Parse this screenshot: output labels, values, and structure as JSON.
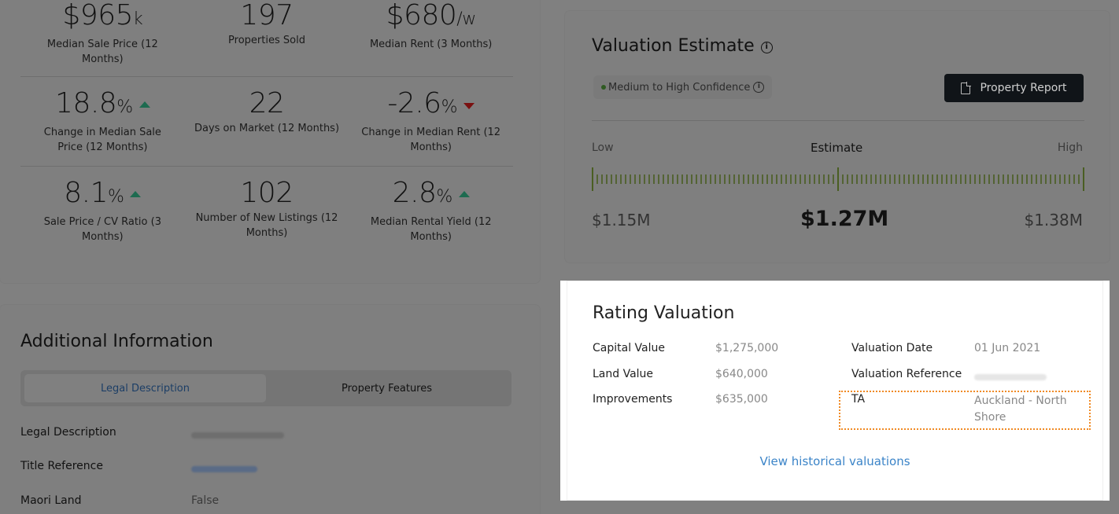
{
  "market_stats": [
    [
      {
        "value": "$965",
        "unit": "k",
        "label": "Median Sale Price (12 Months)",
        "trend": ""
      },
      {
        "value": "197",
        "unit": "",
        "label": "Properties Sold",
        "trend": ""
      },
      {
        "value": "$680",
        "unit": "/w",
        "label": "Median Rent (3 Months)",
        "trend": ""
      }
    ],
    [
      {
        "value": "18.8",
        "unit": "%",
        "label": "Change in Median Sale Price (12 Months)",
        "trend": "up"
      },
      {
        "value": "22",
        "unit": "",
        "label": "Days on Market (12 Months)",
        "trend": ""
      },
      {
        "value": "-2.6",
        "unit": "%",
        "label": "Change in Median Rent (12 Months)",
        "trend": "down"
      }
    ],
    [
      {
        "value": "8.1",
        "unit": "%",
        "label": "Sale Price / CV Ratio (3 Months)",
        "trend": "up"
      },
      {
        "value": "102",
        "unit": "",
        "label": "Number of New Listings (12 Months)",
        "trend": ""
      },
      {
        "value": "2.8",
        "unit": "%",
        "label": "Median Rental Yield (12 Months)",
        "trend": "up"
      }
    ]
  ],
  "additional_info": {
    "title": "Additional Information",
    "tabs": [
      {
        "label": "Legal Description",
        "active": true
      },
      {
        "label": "Property Features",
        "active": false
      }
    ],
    "rows": [
      {
        "key": "Legal Description",
        "value": ""
      },
      {
        "key": "Title Reference",
        "value": ""
      },
      {
        "key": "Maori Land",
        "value": "False"
      }
    ]
  },
  "valuation_estimate": {
    "title": "Valuation Estimate",
    "info_icon": "info-icon",
    "confidence": "Medium to High Confidence",
    "report_button": "Property Report",
    "low_label": "Low",
    "estimate_label": "Estimate",
    "high_label": "High",
    "low_value": "$1.15M",
    "estimate_value": "$1.27M",
    "high_value": "$1.38M",
    "accent_color": "#8ab33a"
  },
  "rating_valuation": {
    "title": "Rating Valuation",
    "left": [
      {
        "key": "Capital Value",
        "value": "$1,275,000"
      },
      {
        "key": "Land Value",
        "value": "$640,000"
      },
      {
        "key": "Improvements",
        "value": "$635,000"
      }
    ],
    "right": [
      {
        "key": "Valuation Date",
        "value": "01 Jun 2021"
      },
      {
        "key": "Valuation Reference",
        "value": ""
      },
      {
        "key": "TA",
        "value": "Auckland - North Shore"
      }
    ],
    "link": "View historical valuations",
    "highlight_color": "#f08a24"
  }
}
